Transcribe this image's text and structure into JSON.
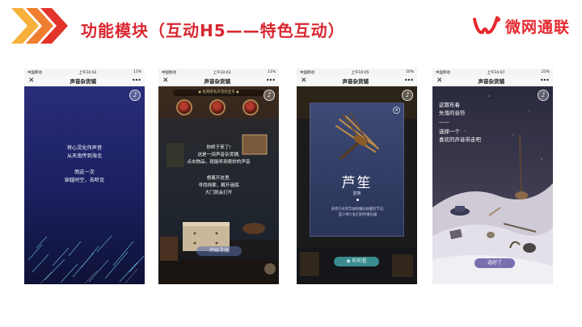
{
  "slide": {
    "title": "功能模块（互动H5——特色互动）",
    "brand_name": "微网通联",
    "colors": {
      "title": "#d92630",
      "chevron_light": "#f6b03b",
      "chevron_mid": "#ef7d2f",
      "chevron_dark": "#e2342b",
      "brand": "#e6282f"
    }
  },
  "phones": [
    {
      "status": {
        "carrier": "中国移动",
        "time": "上午10:02",
        "battery": "11%"
      },
      "nav_title": "声音杂货铺",
      "icons": {
        "close": "close-icon",
        "more": "more-icon",
        "music": "music-icon"
      },
      "poem": [
        "将心灵化作声音",
        "从天南传到海北",
        "",
        "而这一次",
        "穿越时空，去听见"
      ]
    },
    {
      "status": {
        "carrier": "中国移动",
        "time": "上午10:03",
        "battery": "11%"
      },
      "nav_title": "声音杂货铺",
      "banner": "◆ 找到所有声音的宝贝 ◆",
      "text": [
        "你终于来了!",
        "这是一间声音杂货铺,",
        "点击物品，就能听到奇妙的声音",
        "",
        "想离开这里,",
        "寻找线索，解开谜底",
        "大门就会打开"
      ],
      "button": "开始寻找"
    },
    {
      "status": {
        "carrier": "中国移动",
        "time": "上午10:05",
        "battery": "10%"
      },
      "nav_title": "声音杂货铺",
      "instrument": "芦笙",
      "ethnic": "苗族",
      "description": [
        "多用于庆贺丰收和婚庆嫁娶的节日,",
        "是少男少女们的传情乐器"
      ],
      "button": "听听看"
    },
    {
      "status": {
        "carrier": "中国移动",
        "time": "上午10:07",
        "battery": "23%"
      },
      "nav_title": "声音杂货铺",
      "text": [
        "这散布着",
        "失落的音符",
        "——",
        "选择一个",
        "喜欢的声音带走吧"
      ],
      "button": "选好了"
    }
  ]
}
